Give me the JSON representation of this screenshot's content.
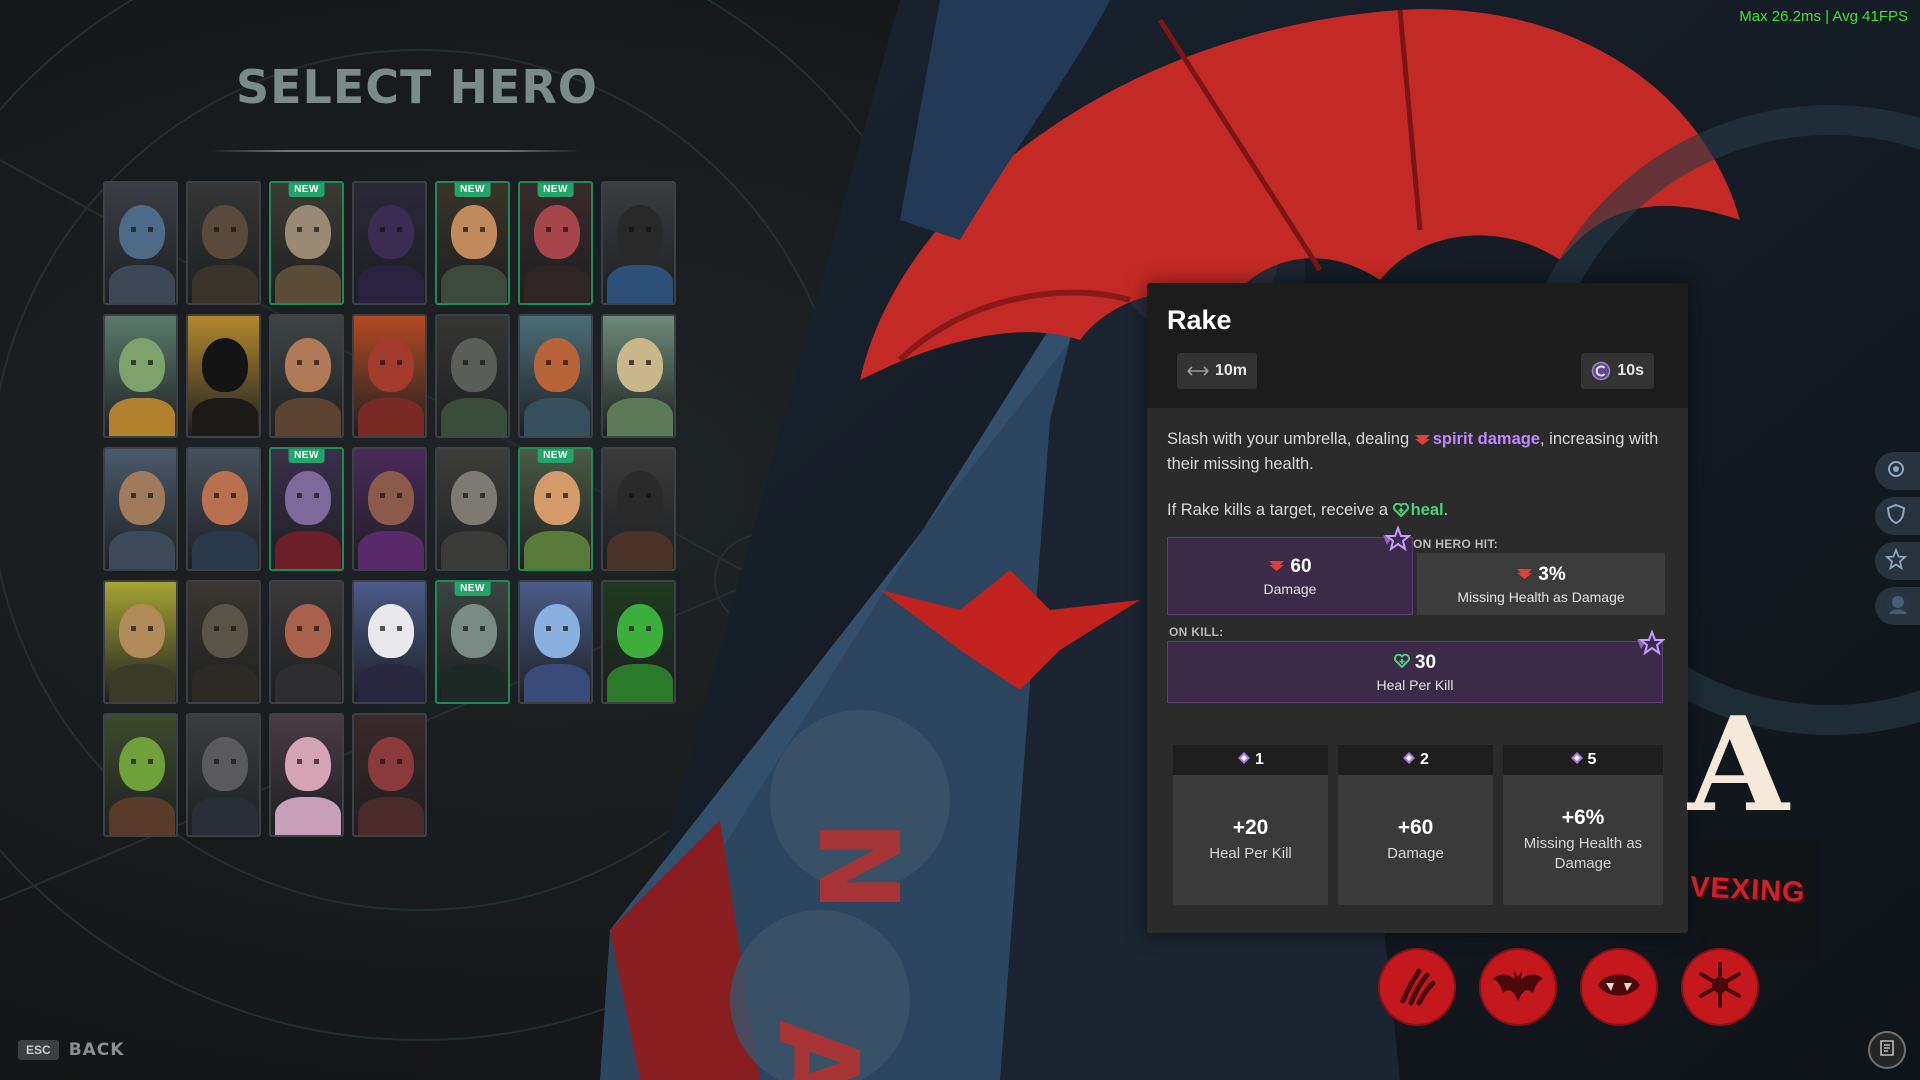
{
  "perf": {
    "fps_text": "Max  26.2ms | Avg   41FPS"
  },
  "title": "SELECT HERO",
  "new_badge": "NEW",
  "heroes": [
    {
      "new": false,
      "skin": "#4d6b86",
      "cloth": "#3d4756",
      "bg": "#3a3e44"
    },
    {
      "new": false,
      "skin": "#5a4a3c",
      "cloth": "#3a332b",
      "bg": "#343534"
    },
    {
      "new": true,
      "skin": "#9a8a74",
      "cloth": "#5a4c36",
      "bg": "#3c3a34"
    },
    {
      "new": false,
      "skin": "#3b2d52",
      "cloth": "#2a2340",
      "bg": "#2b2838"
    },
    {
      "new": true,
      "skin": "#c08a5c",
      "cloth": "#3b4a3d",
      "bg": "#3a3328"
    },
    {
      "new": true,
      "skin": "#a6454a",
      "cloth": "#2f2525",
      "bg": "#3a2a2a"
    },
    {
      "new": false,
      "skin": "#2a2a2a",
      "cloth": "#2d4f78",
      "bg": "#3b3c3f"
    },
    {
      "new": false,
      "skin": "#7ea26b",
      "cloth": "#b2812e",
      "bg": "#5b7a6c"
    },
    {
      "new": false,
      "skin": "#141414",
      "cloth": "#1c1a18",
      "bg": "#b3882c"
    },
    {
      "new": false,
      "skin": "#b07a58",
      "cloth": "#5c4330",
      "bg": "#3f4544"
    },
    {
      "new": false,
      "skin": "#a33a2c",
      "cloth": "#7a2a25",
      "bg": "#b44a22"
    },
    {
      "new": false,
      "skin": "#5b5d58",
      "cloth": "#3a4c3b",
      "bg": "#353534"
    },
    {
      "new": false,
      "skin": "#b86438",
      "cloth": "#35505c",
      "bg": "#4b6f77"
    },
    {
      "new": false,
      "skin": "#c9b68a",
      "cloth": "#5c7a56",
      "bg": "#6d8a78"
    },
    {
      "new": false,
      "skin": "#a07a5a",
      "cloth": "#3c4a5a",
      "bg": "#4a5a6a"
    },
    {
      "new": false,
      "skin": "#b8704f",
      "cloth": "#29384a",
      "bg": "#46505c"
    },
    {
      "new": true,
      "skin": "#7d6a9a",
      "cloth": "#6b1f28",
      "bg": "#3a304a"
    },
    {
      "new": false,
      "skin": "#8c5a4a",
      "cloth": "#5a2a6a",
      "bg": "#4a2a5a"
    },
    {
      "new": false,
      "skin": "#7c7a72",
      "cloth": "#3a3a38",
      "bg": "#3d3d3b"
    },
    {
      "new": true,
      "skin": "#d49a6a",
      "cloth": "#5a7a3a",
      "bg": "#4a5a44"
    },
    {
      "new": false,
      "skin": "#2b2b2b",
      "cloth": "#4a3228",
      "bg": "#3a3a3a"
    },
    {
      "new": false,
      "skin": "#b08a58",
      "cloth": "#3a3a28",
      "bg": "#a4a432"
    },
    {
      "new": false,
      "skin": "#5a5448",
      "cloth": "#2e2a26",
      "bg": "#3a3630"
    },
    {
      "new": false,
      "skin": "#a8614a",
      "cloth": "#2e2e30",
      "bg": "#3a3838"
    },
    {
      "new": false,
      "skin": "#e8e8ec",
      "cloth": "#2a2840",
      "bg": "#4a5a8a"
    },
    {
      "new": true,
      "skin": "#7a8a84",
      "cloth": "#1e2a26",
      "bg": "#3a4440"
    },
    {
      "new": false,
      "skin": "#8ab0e0",
      "cloth": "#3a4a7a",
      "bg": "#4a5c8a"
    },
    {
      "new": false,
      "skin": "#3cae3c",
      "cloth": "#2a7a2a",
      "bg": "#1e3a1e"
    },
    {
      "new": false,
      "skin": "#6fa03a",
      "cloth": "#5a3a28",
      "bg": "#3c4a2c"
    },
    {
      "new": false,
      "skin": "#5a5a5e",
      "cloth": "#2a2e36",
      "bg": "#3a3c40"
    },
    {
      "new": false,
      "skin": "#d4a4b4",
      "cloth": "#c8a0b8",
      "bg": "#4a3a44"
    },
    {
      "new": false,
      "skin": "#8a3a3a",
      "cloth": "#4a2a2a",
      "bg": "#3a2a2a"
    }
  ],
  "back": {
    "key": "ESC",
    "label": "BACK"
  },
  "ability": {
    "name": "Rake",
    "range": "10m",
    "cooldown": "10s",
    "desc_1_pre": "Slash with your umbrella, dealing ",
    "desc_1_kw": "spirit damage",
    "desc_1_post": ", increasing with their missing health.",
    "desc_2_pre": "If Rake kills a target, receive a ",
    "desc_2_kw": "heal",
    "desc_2_post": ".",
    "on_hero_hit_label": "ON HERO HIT:",
    "on_kill_label": "ON KILL:",
    "stats": {
      "damage_value": "60",
      "damage_label": "Damage",
      "missing_value": "3%",
      "missing_label": "Missing Health as Damage",
      "heal_value": "30",
      "heal_label": "Heal Per Kill"
    },
    "upgrades": [
      {
        "cost": "1",
        "value": "+20",
        "label": "Heal Per Kill"
      },
      {
        "cost": "2",
        "value": "+60",
        "label": "Damage"
      },
      {
        "cost": "5",
        "value": "+6%",
        "label": "Missing Health as Damage"
      }
    ]
  },
  "hero_logo_letter": "A",
  "hero_tag": "VEXING",
  "colors": {
    "accent_red": "#c4181d",
    "spirit_purple": "#c585ff",
    "heal_green": "#49d27c",
    "new_green": "#21a56a",
    "fps_green": "#3fe23a"
  }
}
